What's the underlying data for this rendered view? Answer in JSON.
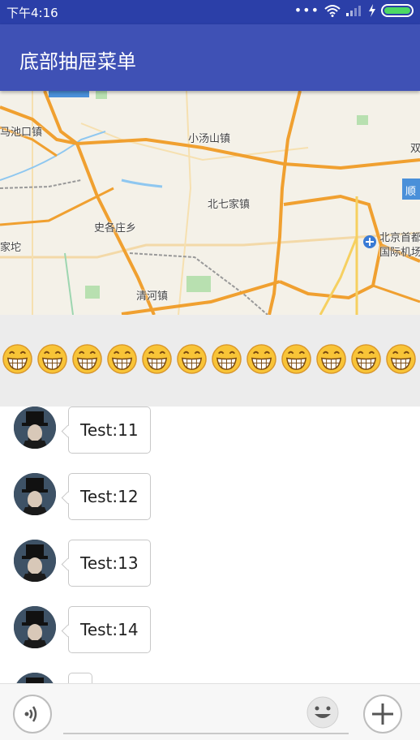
{
  "status_bar": {
    "time": "下午4:16",
    "icons": [
      "more-dots-icon",
      "wifi-icon",
      "signal-icon",
      "charging-icon",
      "battery-icon"
    ]
  },
  "toolbar": {
    "title": "底部抽屉菜单"
  },
  "map": {
    "labels": {
      "l1": "马池口镇",
      "l2": "小汤山镇",
      "l3": "北七家镇",
      "l4": "史各庄乡",
      "l5": "家坨",
      "l6": "清河镇",
      "l7": "北京首都",
      "l8": "国际机场",
      "l9": "顺",
      "l10": "双"
    }
  },
  "emoji_bar": {
    "emoji": "grinning-face-icon",
    "count": 12
  },
  "chat": {
    "messages": [
      {
        "text": "Test:11"
      },
      {
        "text": "Test:12"
      },
      {
        "text": "Test:13"
      },
      {
        "text": "Test:14"
      },
      {
        "text": ""
      }
    ]
  },
  "input_bar": {
    "voice_icon": "voice-wave-icon",
    "emoji_icon": "smiley-icon",
    "add_icon": "plus-icon",
    "input_value": "",
    "placeholder": ""
  },
  "colors": {
    "status_bar": "#2b3fa8",
    "toolbar": "#3f51b5",
    "emoji_bar": "#ececec",
    "road": "#f0a030",
    "battery": "#4cd964"
  }
}
